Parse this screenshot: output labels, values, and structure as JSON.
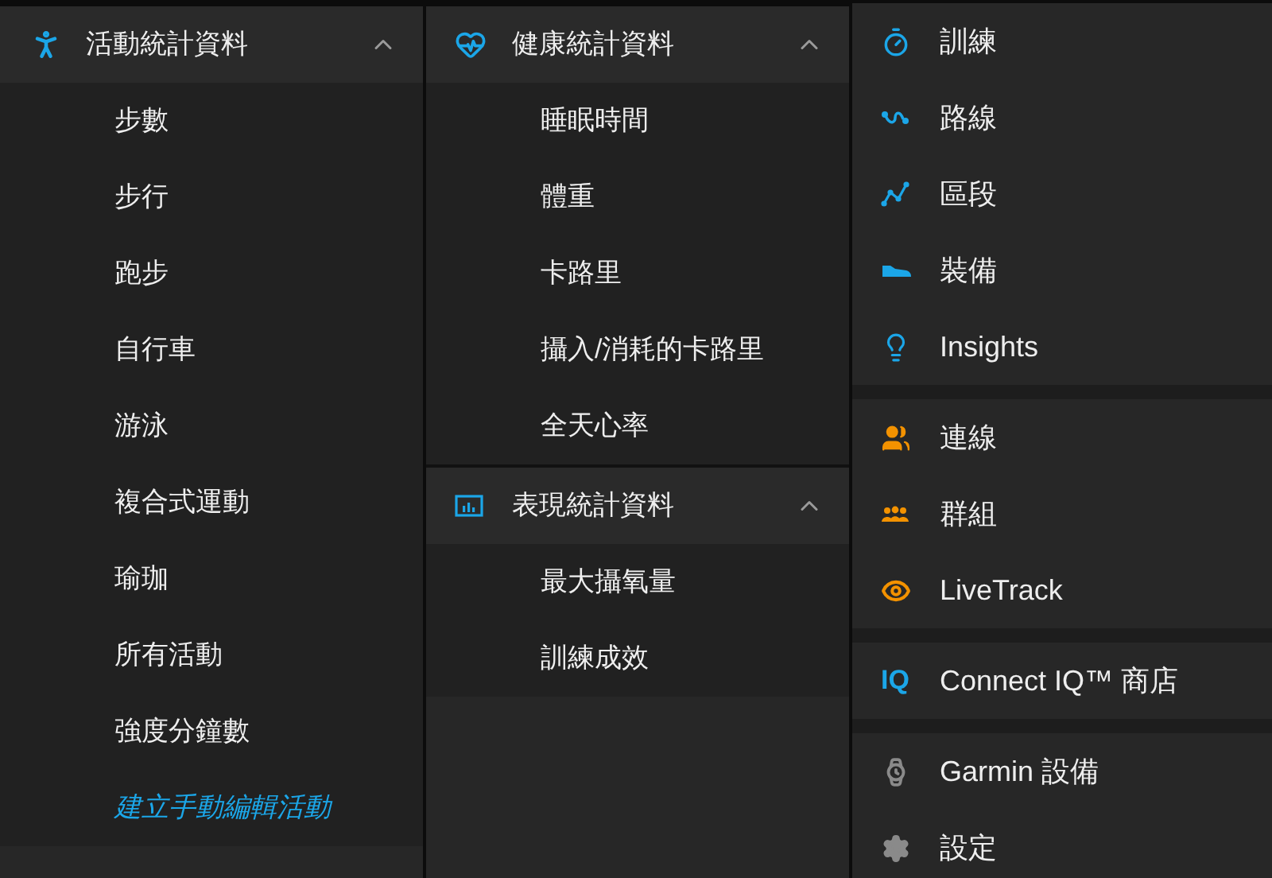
{
  "activity_panel": {
    "sections": [
      {
        "title": "活動統計資料",
        "expanded": true,
        "items": [
          {
            "label": "步數",
            "kind": "link"
          },
          {
            "label": "步行",
            "kind": "link"
          },
          {
            "label": "跑步",
            "kind": "link"
          },
          {
            "label": "自行車",
            "kind": "link"
          },
          {
            "label": "游泳",
            "kind": "link"
          },
          {
            "label": "複合式運動",
            "kind": "link"
          },
          {
            "label": "瑜珈",
            "kind": "link"
          },
          {
            "label": "所有活動",
            "kind": "link"
          },
          {
            "label": "強度分鐘數",
            "kind": "link"
          },
          {
            "label": "建立手動編輯活動",
            "kind": "action"
          }
        ]
      }
    ]
  },
  "health_panel": {
    "sections": [
      {
        "title": "健康統計資料",
        "expanded": true,
        "items": [
          {
            "label": "睡眠時間",
            "kind": "link"
          },
          {
            "label": "體重",
            "kind": "link"
          },
          {
            "label": "卡路里",
            "kind": "link"
          },
          {
            "label": "攝入/消耗的卡路里",
            "kind": "link"
          },
          {
            "label": "全天心率",
            "kind": "link"
          }
        ]
      },
      {
        "title": "表現統計資料",
        "expanded": true,
        "items": [
          {
            "label": "最大攝氧量",
            "kind": "link"
          },
          {
            "label": "訓練成效",
            "kind": "link"
          }
        ]
      }
    ]
  },
  "menu_panel": {
    "groups": [
      [
        {
          "label": "訓練",
          "color": "#1ba6e8"
        },
        {
          "label": "路線",
          "color": "#1ba6e8"
        },
        {
          "label": "區段",
          "color": "#1ba6e8"
        },
        {
          "label": "裝備",
          "color": "#1ba6e8"
        },
        {
          "label": "Insights",
          "color": "#1ba6e8"
        }
      ],
      [
        {
          "label": "連線",
          "color": "#f39200"
        },
        {
          "label": "群組",
          "color": "#f39200"
        },
        {
          "label": "LiveTrack",
          "color": "#f39200"
        }
      ],
      [
        {
          "label": "Connect IQ™ 商店",
          "color": "#1ba6e8",
          "logo_text": "IQ"
        }
      ],
      [
        {
          "label": "Garmin 設備",
          "color": "#8a8a8a"
        },
        {
          "label": "設定",
          "color": "#8a8a8a"
        }
      ]
    ]
  }
}
